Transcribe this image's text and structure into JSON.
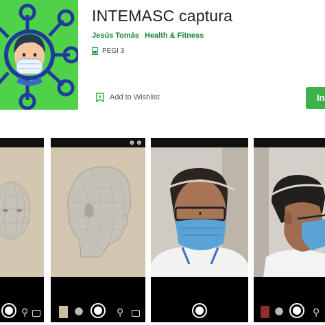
{
  "app": {
    "title": "INTEMASC captura",
    "developer": "Jesús Tomás",
    "category": "Health & Fitness",
    "rating": "PEGI 3",
    "wishlist_label": "Add to Wishlist",
    "install_label": "In"
  },
  "icons": {
    "app_icon": "masked-face-network-icon",
    "pegi": "pegi-badge-icon",
    "wishlist": "bookmark-add-icon",
    "shutter": "camera-shutter-icon",
    "switch_camera": "switch-camera-icon"
  },
  "colors": {
    "accent_green": "#11803a",
    "icon_background": "#4fd24a",
    "network_blue": "#1f3c9a",
    "install_button": "#3bb34a"
  },
  "screenshots": [
    {
      "subject": "3d-head-front"
    },
    {
      "subject": "3d-head-side"
    },
    {
      "subject": "person-with-mask-front"
    },
    {
      "subject": "person-with-mask-side"
    }
  ]
}
